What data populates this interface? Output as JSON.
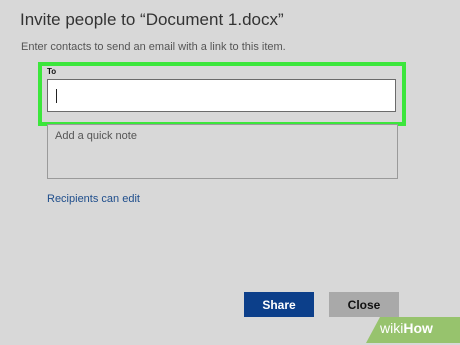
{
  "dialog": {
    "title": "Invite people to “Document 1.docx”",
    "subtitle": "Enter contacts to send an email with a link to this item.",
    "to_label": "To",
    "to_value": "",
    "note_placeholder": "Add a quick note",
    "recipients_link": "Recipients can edit",
    "share_label": "Share",
    "close_label": "Close"
  },
  "watermark": {
    "prefix": "wiki",
    "suffix": "How"
  },
  "colors": {
    "highlight": "#3ce63c",
    "share_button": "#0c3f8a",
    "close_button": "#a9a9a9",
    "link": "#1f4e8c"
  }
}
